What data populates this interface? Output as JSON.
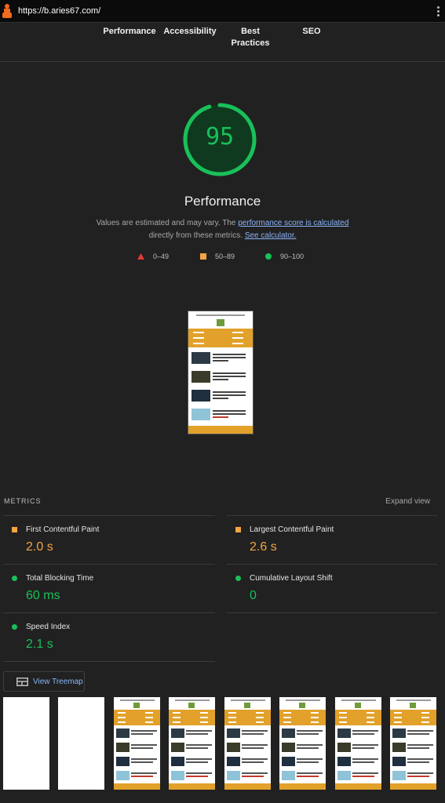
{
  "browser": {
    "url": "https://b.aries67.com/"
  },
  "tabs": [
    "Performance",
    "Accessibility",
    "Best Practices",
    "SEO"
  ],
  "gauge": {
    "score": "95",
    "title": "Performance",
    "color": "#19c05a"
  },
  "description": {
    "prefix": "Values are estimated and may vary. The ",
    "link1": "performance score is calculated",
    "middle": "directly from these metrics. ",
    "link2": "See calculator."
  },
  "legend": {
    "fail": "0–49",
    "average": "50–89",
    "pass": "90–100"
  },
  "metrics": {
    "heading": "METRICS",
    "expand": "Expand view",
    "fcp": {
      "label": "First Contentful Paint",
      "value": "2.0 s",
      "status": "average"
    },
    "lcp": {
      "label": "Largest Contentful Paint",
      "value": "2.6 s",
      "status": "average"
    },
    "tbt": {
      "label": "Total Blocking Time",
      "value": "60 ms",
      "status": "pass"
    },
    "cls": {
      "label": "Cumulative Layout Shift",
      "value": "0",
      "status": "pass"
    },
    "si": {
      "label": "Speed Index",
      "value": "2.1 s",
      "status": "pass"
    }
  },
  "treemap": {
    "label": "View Treemap",
    "icon": "treemap-icon"
  },
  "colors": {
    "pass": "#19c05a",
    "average": "#f3a541",
    "fail": "#e53935",
    "link": "#8ab4f8",
    "site_accent": "#e2a12a"
  }
}
